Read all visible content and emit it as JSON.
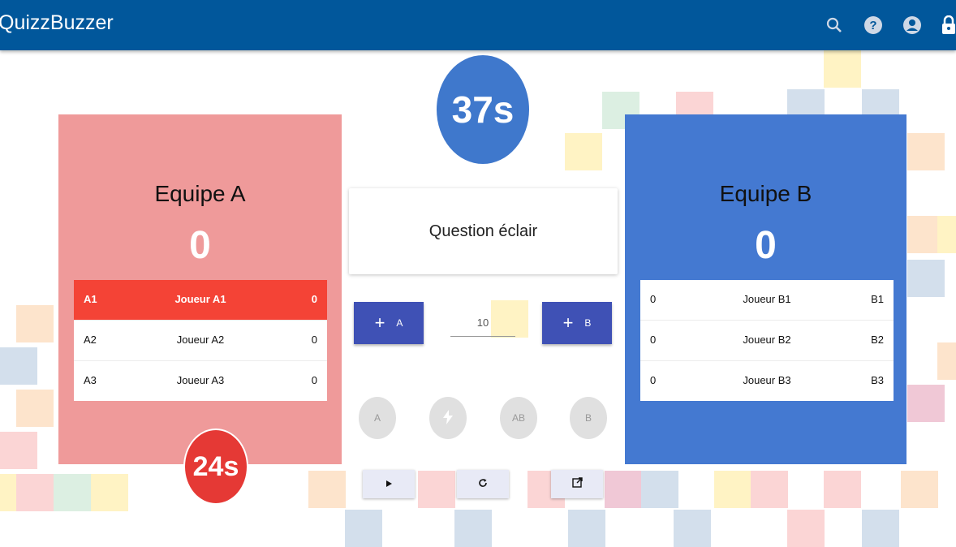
{
  "app": {
    "title": "QuizzBuzzer"
  },
  "header_icons": [
    "search-icon",
    "help-icon",
    "account-icon",
    "lock-icon"
  ],
  "colors": {
    "header": "#01579b",
    "team_a": "#ef9a9a",
    "team_a_active": "#f44336",
    "team_b": "#4479d1",
    "timer_main": "#3f78cc",
    "timer_a": "#e53935",
    "add_button": "#3f51b5"
  },
  "timer_main": "37s",
  "team_a": {
    "name": "Equipe A",
    "score": "0",
    "timer": "24s",
    "players": [
      {
        "id": "A1",
        "name": "Joueur A1",
        "score": "0"
      },
      {
        "id": "A2",
        "name": "Joueur A2",
        "score": "0"
      },
      {
        "id": "A3",
        "name": "Joueur A3",
        "score": "0"
      }
    ]
  },
  "team_b": {
    "name": "Equipe B",
    "score": "0",
    "players": [
      {
        "id": "B1",
        "name": "Joueur B1",
        "score": "0"
      },
      {
        "id": "B2",
        "name": "Joueur B2",
        "score": "0"
      },
      {
        "id": "B3",
        "name": "Joueur B3",
        "score": "0"
      }
    ]
  },
  "question": {
    "title": "Question éclair"
  },
  "controls": {
    "add_a": {
      "icon": "+",
      "label": "A"
    },
    "add_b": {
      "icon": "+",
      "label": "B"
    },
    "points_value": "10",
    "round_buttons": {
      "a": "A",
      "flash": "lightning-icon",
      "ab": "AB",
      "b": "B"
    },
    "bottom_buttons": [
      "play-icon",
      "refresh-icon",
      "open-external-icon"
    ]
  }
}
